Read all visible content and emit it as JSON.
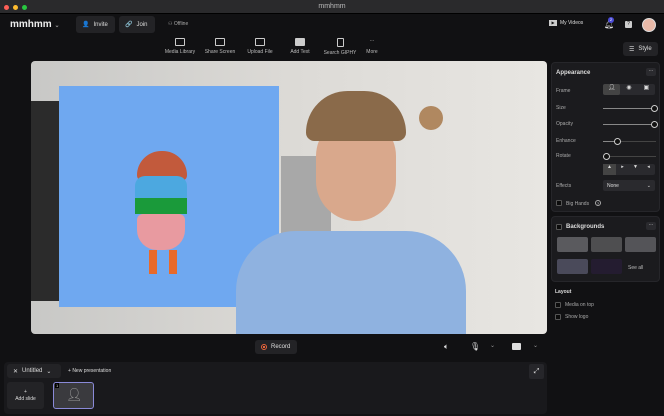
{
  "window": {
    "title": "mmhmm"
  },
  "header": {
    "logo": "mmhmm",
    "invite": "Invite",
    "join": "Join",
    "status": "Offline",
    "my_videos": "My Videos",
    "notification_count": "2",
    "style": "Style"
  },
  "toolbar": [
    {
      "label": "Media Library",
      "icon": "media-library-icon"
    },
    {
      "label": "Share Screen",
      "icon": "monitor-icon"
    },
    {
      "label": "Upload File",
      "icon": "upload-icon"
    },
    {
      "label": "Add Text",
      "icon": "text-icon"
    },
    {
      "label": "Search GIPHY",
      "icon": "file-icon"
    },
    {
      "label": "More",
      "icon": "more-icon"
    }
  ],
  "appearance": {
    "title": "Appearance",
    "frame": "Frame",
    "size": "Size",
    "size_value": 1.0,
    "opacity": "Opacity",
    "opacity_value": 1.0,
    "enhance": "Enhance",
    "enhance_value": 0.25,
    "rotate": "Rotate",
    "rotate_value": 0,
    "effects": "Effects",
    "effects_value": "None",
    "big_hands": "Big Hands"
  },
  "backgrounds": {
    "title": "Backgrounds",
    "see_all": "See all"
  },
  "layout": {
    "title": "Layout",
    "media_on_top": "Media on top",
    "show_logo": "Show logo"
  },
  "controls": {
    "record": "Record"
  },
  "presentation": {
    "name": "Untitled",
    "new": "New presentation",
    "add_slide": "Add slide",
    "slide_number": "1"
  },
  "colors": {
    "accent": "#6b6bd6",
    "record": "#e8643a",
    "card_blue": "#6fa8f0"
  }
}
